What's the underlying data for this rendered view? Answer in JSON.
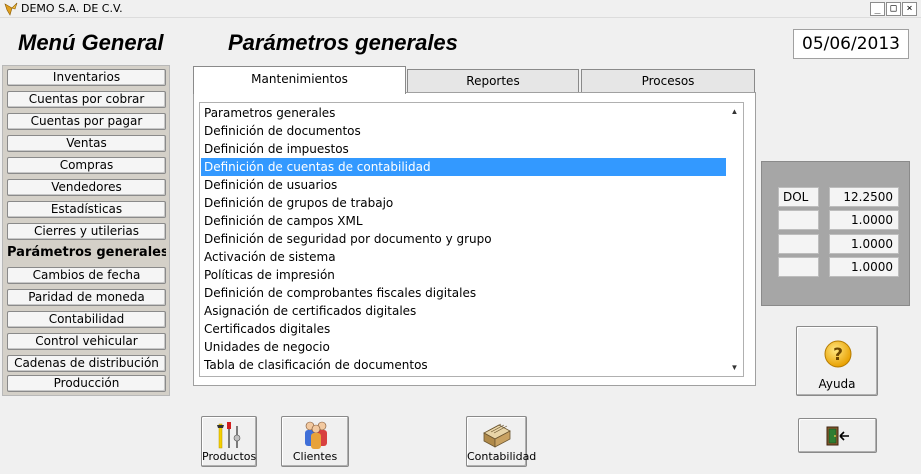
{
  "window": {
    "title": "DEMO  S.A. DE C.V.",
    "controls": [
      "_",
      "□",
      "×"
    ]
  },
  "header": {
    "menu_title": "Menú General",
    "section_title": "Parámetros generales",
    "date": "05/06/2013"
  },
  "menu": {
    "items": [
      {
        "label": "Inventarios"
      },
      {
        "label": "Cuentas por cobrar"
      },
      {
        "label": "Cuentas por pagar"
      },
      {
        "label": "Ventas"
      },
      {
        "label": "Compras"
      },
      {
        "label": "Vendedores"
      },
      {
        "label": "Estadísticas"
      },
      {
        "label": "Cierres y utilerias"
      },
      {
        "label": "Parámetros generales",
        "active": true
      },
      {
        "label": "Cambios de fecha"
      },
      {
        "label": "Paridad de moneda"
      },
      {
        "label": "Contabilidad"
      },
      {
        "label": "Control vehicular"
      },
      {
        "label": "Cadenas de distribución"
      },
      {
        "label": "Producción"
      }
    ]
  },
  "tabs": [
    {
      "label": "Mantenimientos",
      "active": true
    },
    {
      "label": "Reportes",
      "active": false
    },
    {
      "label": "Procesos",
      "active": false
    }
  ],
  "list": {
    "items": [
      "Parametros generales",
      "Definición de documentos",
      "Definición de impuestos",
      "Definición de cuentas de contabilidad",
      "Definición de usuarios",
      "Definición de grupos de trabajo",
      "Definición de campos XML",
      "Definición de seguridad por documento y grupo",
      "Activación  de sistema",
      "Políticas de  impresión",
      "Definición de comprobantes fiscales digitales",
      "Asignación de certificados digitales",
      "Certificados digitales",
      "Unidades de negocio",
      "Tabla de clasificación de documentos"
    ],
    "selected_index": 3
  },
  "currencies": [
    {
      "code": "DOL",
      "rate": "12.2500"
    },
    {
      "code": "",
      "rate": "1.0000"
    },
    {
      "code": "",
      "rate": "1.0000"
    },
    {
      "code": "",
      "rate": "1.0000"
    }
  ],
  "buttons": {
    "help": "Ayuda",
    "products": "Productos",
    "clients": "Clientes",
    "accounting": "Contabilidad"
  },
  "colors": {
    "selection": "#3399ff",
    "panel_gray": "#a6a6a6",
    "help_icon": "#f2b500"
  }
}
